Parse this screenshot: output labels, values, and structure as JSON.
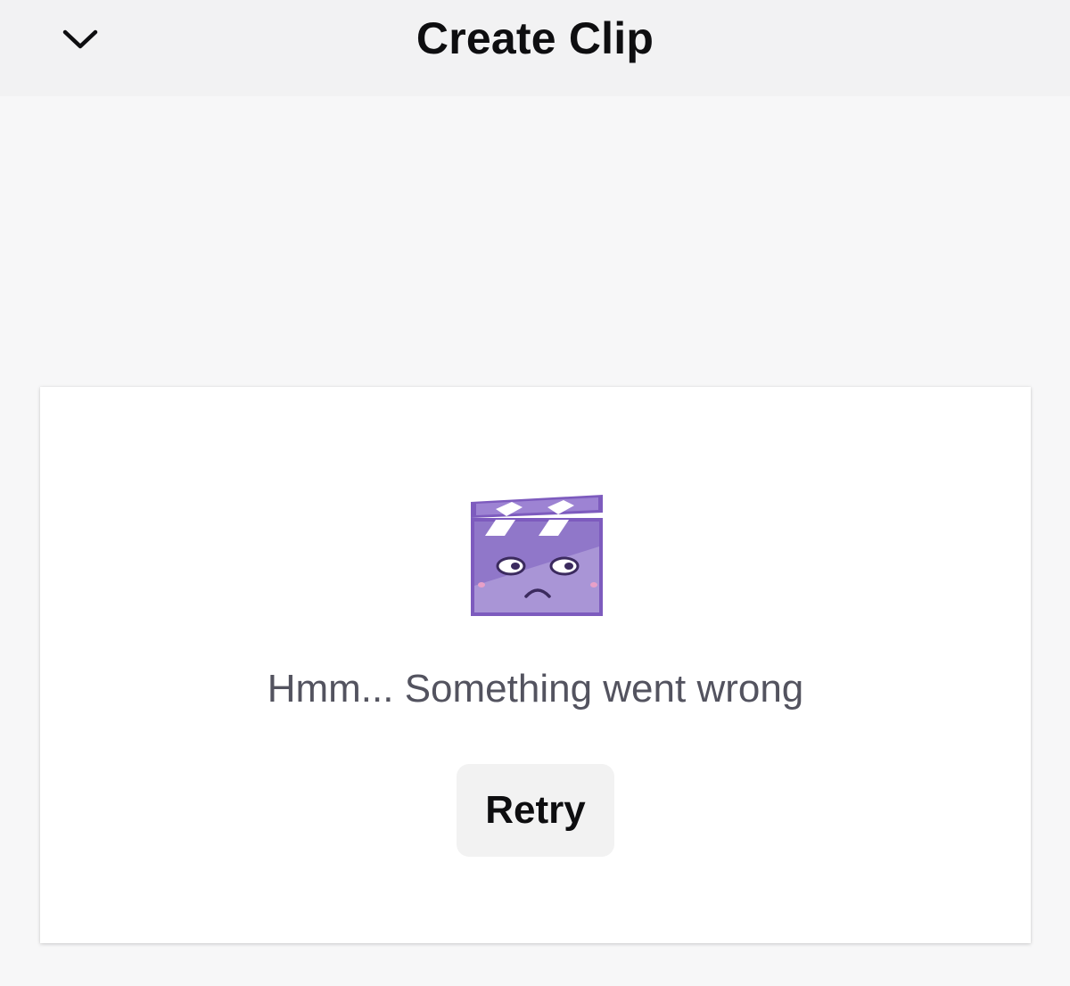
{
  "header": {
    "title": "Create Clip",
    "collapse_icon": "chevron-down-icon"
  },
  "error": {
    "illustration_icon": "sad-clapperboard-icon",
    "message": "Hmm... Something went wrong",
    "retry_label": "Retry"
  },
  "colors": {
    "brand_purple": "#7d5bbe",
    "illustration_light": "#a995d6",
    "background": "#f7f7f8",
    "card": "#ffffff",
    "button": "#f2f2f2",
    "message_text": "#53535f"
  }
}
